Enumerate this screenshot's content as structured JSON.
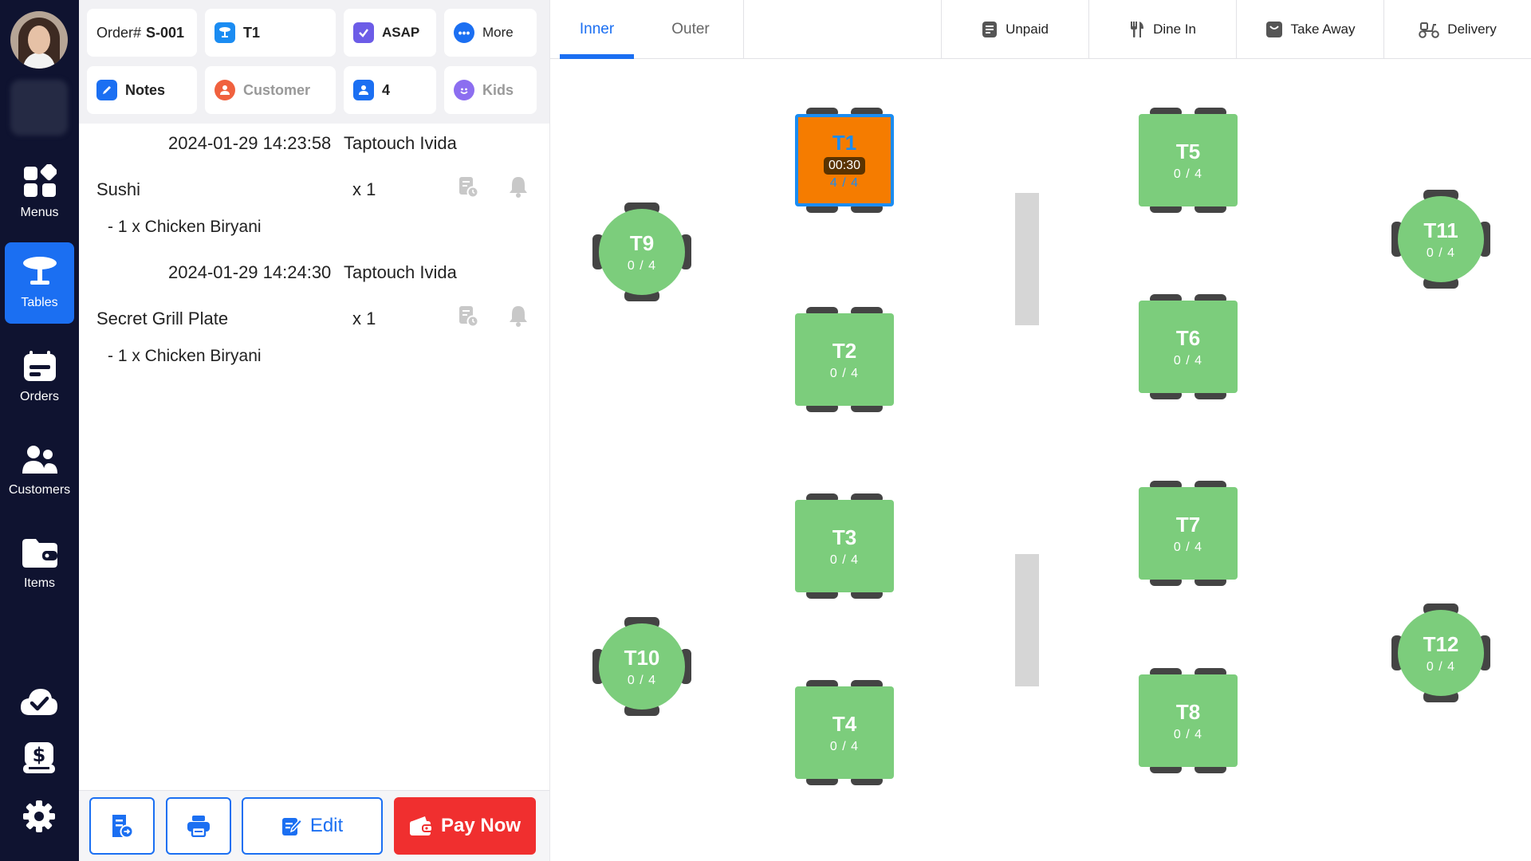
{
  "nav": {
    "items": [
      {
        "label": "Menus",
        "icon": "grid-icon"
      },
      {
        "label": "Tables",
        "icon": "table-icon",
        "active": true
      },
      {
        "label": "Orders",
        "icon": "orders-icon"
      },
      {
        "label": "Customers",
        "icon": "customers-icon"
      },
      {
        "label": "Items",
        "icon": "folder-icon"
      }
    ],
    "bottom_icons": [
      "cloud-check-icon",
      "cash-icon",
      "settings-icon"
    ]
  },
  "header": {
    "order_prefix": "Order#",
    "order_number": "S-001",
    "table": "T1",
    "timing": "ASAP",
    "more": "More",
    "notes": "Notes",
    "customer": "Customer",
    "guests": "4",
    "kids": "Kids"
  },
  "order_log": [
    {
      "timestamp": "2024-01-29 14:23:58",
      "user": "Taptouch Ivida",
      "item": "Sushi",
      "qty": "x 1",
      "modifier": "- 1 x Chicken Biryani"
    },
    {
      "timestamp": "2024-01-29 14:24:30",
      "user": "Taptouch Ivida",
      "item": "Secret Grill Plate",
      "qty": "x 1",
      "modifier": "- 1 x Chicken Biryani"
    }
  ],
  "actions": {
    "edit": "Edit",
    "pay_now": "Pay Now"
  },
  "floor": {
    "tabs": [
      "Inner",
      "Outer"
    ],
    "active_tab": "Inner",
    "filters": [
      "Unpaid",
      "Dine In",
      "Take Away",
      "Delivery"
    ],
    "tables": [
      {
        "name": "T1",
        "count": "4 / 4",
        "timer": "00:30",
        "status": "occupied",
        "selected": true
      },
      {
        "name": "T2",
        "count": "0 / 4"
      },
      {
        "name": "T3",
        "count": "0 / 4"
      },
      {
        "name": "T4",
        "count": "0 / 4"
      },
      {
        "name": "T5",
        "count": "0 / 4"
      },
      {
        "name": "T6",
        "count": "0 / 4"
      },
      {
        "name": "T7",
        "count": "0 / 4"
      },
      {
        "name": "T8",
        "count": "0 / 4"
      },
      {
        "name": "T9",
        "count": "0 / 4"
      },
      {
        "name": "T10",
        "count": "0 / 4"
      },
      {
        "name": "T11",
        "count": "0 / 4"
      },
      {
        "name": "T12",
        "count": "0 / 4"
      }
    ]
  },
  "colors": {
    "nav_bg": "#0f1330",
    "accent": "#1b6ff2",
    "free_table": "#7ccd7c",
    "occupied_table": "#f57c00",
    "pay_button": "#f02f2f"
  }
}
